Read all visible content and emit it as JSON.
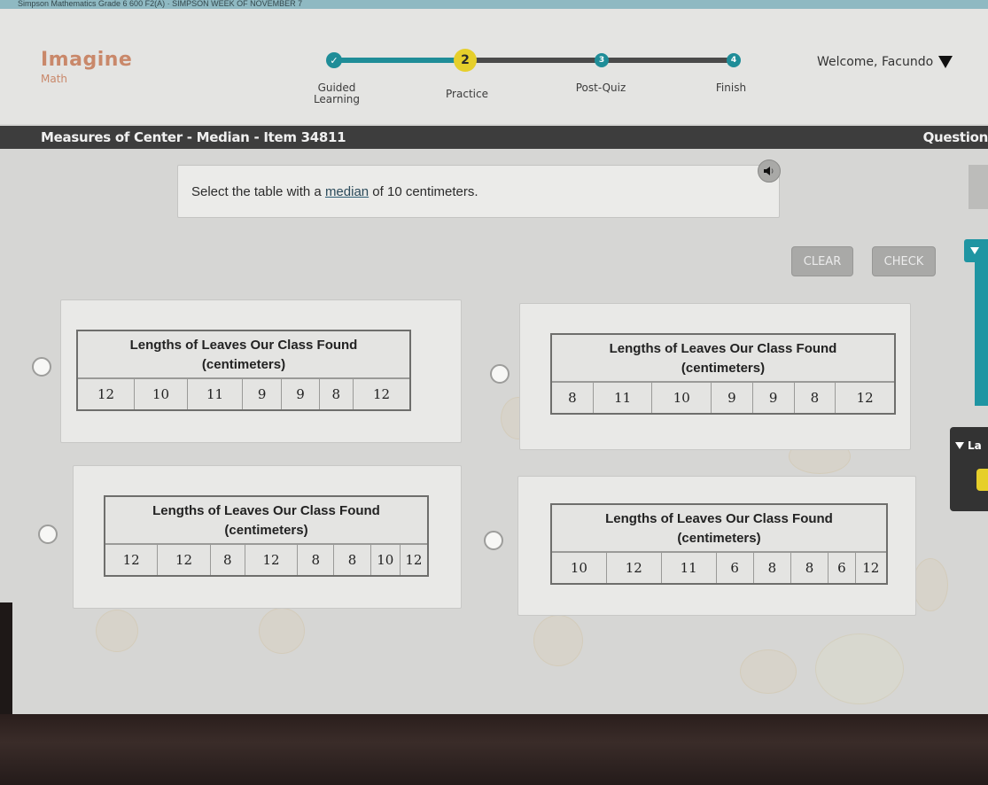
{
  "top_strip": {
    "text": "Simpson Mathematics Grade 6 600 F2(A) · SIMPSON WEEK OF NOVEMBER 7"
  },
  "brand": {
    "name": "Imagine",
    "subject": "Math"
  },
  "progress": {
    "steps": [
      {
        "marker": "✓",
        "label_line1": "Guided",
        "label_line2": "Learning",
        "status": "complete"
      },
      {
        "marker": "2",
        "label_line1": "Practice",
        "label_line2": "",
        "status": "current"
      },
      {
        "marker": "3",
        "label_line1": "Post-Quiz",
        "label_line2": "",
        "status": "upcoming"
      },
      {
        "marker": "4",
        "label_line1": "Finish",
        "label_line2": "",
        "status": "upcoming"
      }
    ]
  },
  "user": {
    "welcome": "Welcome, Facundo"
  },
  "titlebar": {
    "title": "Measures of Center - Median - Item 34811",
    "mode": "Question"
  },
  "prompt": {
    "before": "Select the table with a ",
    "link": "median",
    "after": " of 10 centimeters."
  },
  "actions": {
    "clear_label": "CLEAR",
    "check_label": "CHECK"
  },
  "side_panel": {
    "collapsed_label": "La"
  },
  "options": [
    {
      "title": "Lengths of Leaves Our Class Found",
      "unit": "(centimeters)",
      "values": [
        "12",
        "10",
        "11",
        "9",
        "9",
        "8",
        "12"
      ],
      "selected": false
    },
    {
      "title": "Lengths of Leaves Our Class Found",
      "unit": "(centimeters)",
      "values": [
        "8",
        "11",
        "10",
        "9",
        "9",
        "8",
        "12"
      ],
      "selected": false
    },
    {
      "title": "Lengths of Leaves Our Class Found",
      "unit": "(centimeters)",
      "values": [
        "12",
        "12",
        "8",
        "12",
        "8",
        "8",
        "10",
        "12"
      ],
      "selected": false
    },
    {
      "title": "Lengths of Leaves Our Class Found",
      "unit": "(centimeters)",
      "values": [
        "10",
        "12",
        "11",
        "6",
        "8",
        "8",
        "6",
        "12"
      ],
      "selected": false
    }
  ],
  "colors": {
    "teal": "#1f8d98",
    "yellow": "#e6cf2b",
    "brand": "#c9886a",
    "titlebar": "#3d3d3d"
  }
}
